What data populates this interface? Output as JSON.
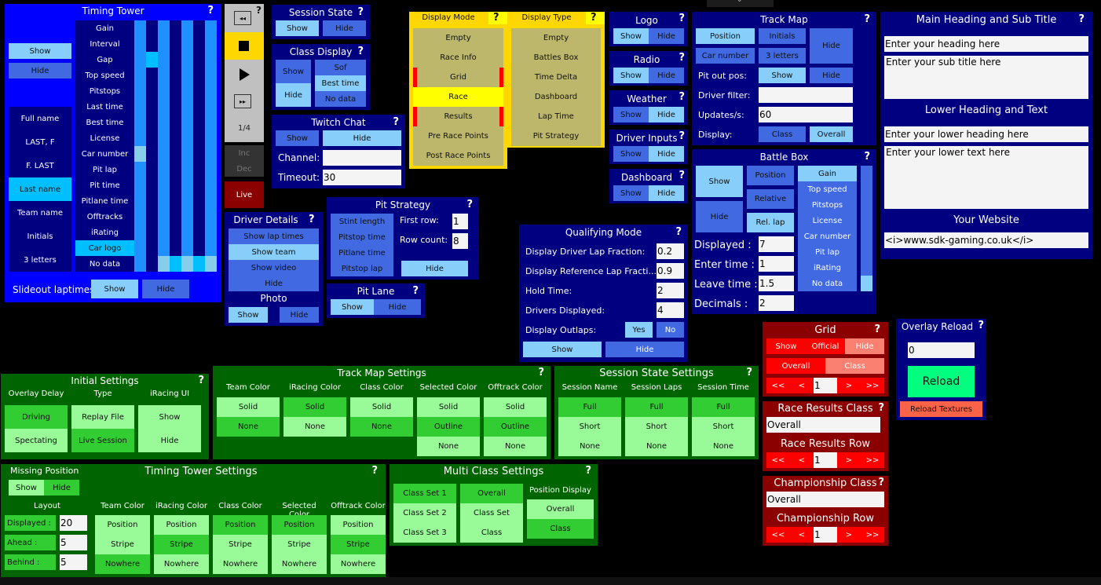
{
  "colors": {
    "panel_blue": "#000080",
    "bright_blue": "#0000ff",
    "light": "#87cefa",
    "mid": "#4169e1",
    "cyan": "#00bfff",
    "yellow": "#ffd700",
    "green": "#006400",
    "red": "#8b0000",
    "reload": "#00ff7f"
  },
  "help": "?",
  "timing_tower": {
    "title": "Timing Tower",
    "show": "Show",
    "hide": "Hide",
    "name_formats": [
      "Full name",
      "LAST, F",
      "F. LAST",
      "Last name",
      "Team name",
      "Initials",
      "3 letters"
    ],
    "selected_name_format": "Last name",
    "columns": [
      "Gain",
      "Interval",
      "Gap",
      "Top speed",
      "Pitstops",
      "Last time",
      "Best time",
      "License",
      "Car number",
      "Pit lap",
      "Pit time",
      "Pitlane time",
      "Offtracks",
      "iRating",
      "Car logo",
      "No data"
    ],
    "selected_column": "Car logo",
    "slideout_label": "Slideout laptimes",
    "slideout_show": "Show",
    "slideout_hide": "Hide"
  },
  "replay": {
    "rewind": "rewind-icon",
    "stop": "stop-icon",
    "play": "play-icon",
    "ffwd": "fast-forward-icon",
    "speed": "1/4",
    "inc": "Inc",
    "dec": "Dec",
    "live": "Live"
  },
  "session_state": {
    "title": "Session State",
    "show": "Show",
    "hide": "Hide"
  },
  "class_display": {
    "title": "Class Display",
    "show": "Show",
    "hide": "Hide",
    "options": [
      "Sof",
      "Best time",
      "No data"
    ]
  },
  "twitch_chat": {
    "title": "Twitch Chat",
    "show": "Show",
    "hide": "Hide",
    "channel_label": "Channel:",
    "channel_value": "",
    "timeout_label": "Timeout:",
    "timeout_value": "30"
  },
  "display_mode": {
    "title": "Display Mode",
    "items": [
      "Empty",
      "Race Info",
      "Grid",
      "Race",
      "Results",
      "Pre Race Points",
      "Post Race Points"
    ],
    "selected": "Race"
  },
  "display_type": {
    "title": "Display Type",
    "items": [
      "Empty",
      "Battles Box",
      "Time Delta",
      "Dashboard",
      "Lap Time",
      "Pit Strategy"
    ]
  },
  "small_panels": [
    {
      "title": "Logo",
      "show": "Show",
      "hide": "Hide"
    },
    {
      "title": "Radio",
      "show": "Show",
      "hide": "Hide"
    },
    {
      "title": "Weather",
      "show": "Show",
      "hide": "Hide"
    },
    {
      "title": "Driver Inputs",
      "show": "Show",
      "hide": "Hide"
    },
    {
      "title": "Dashboard",
      "show": "Show",
      "hide": "Hide"
    }
  ],
  "track_map": {
    "title": "Track Map",
    "position": "Position",
    "initials": "Initials",
    "car_number": "Car number",
    "three_letters": "3 letters",
    "hide": "Hide",
    "pit_out_label": "Pit out pos:",
    "pit_show": "Show",
    "pit_hide": "Hide",
    "driver_filter_label": "Driver filter:",
    "driver_filter_value": "",
    "updates_label": "Updates/s:",
    "updates_value": "60",
    "display_label": "Display:",
    "class": "Class",
    "overall": "Overall"
  },
  "battle_box": {
    "title": "Battle Box",
    "show": "Show",
    "hide": "Hide",
    "position": "Position",
    "relative": "Relative",
    "rel_lap": "Rel. lap",
    "columns": [
      "Gain",
      "Top speed",
      "Pitstops",
      "License",
      "Car number",
      "Pit lap",
      "iRating",
      "No data"
    ],
    "displayed_label": "Displayed :",
    "displayed_value": "7",
    "enter_label": "Enter time :",
    "enter_value": "1",
    "leave_label": "Leave time :",
    "leave_value": "1.5",
    "decimals_label": "Decimals :",
    "decimals_value": "2"
  },
  "headings": {
    "main_title": "Main Heading and Sub Title",
    "heading_value": "Enter your heading here",
    "subtitle_value": "Enter your sub title here",
    "lower_title": "Lower Heading and Text",
    "lower_heading_value": "Enter your lower heading here",
    "lower_text_value": "Enter your lower text here",
    "website_title": "Your Website",
    "website_value": "<i>www.sdk-gaming.co.uk</i>"
  },
  "driver_details": {
    "title": "Driver Details",
    "items": [
      "Show lap times",
      "Show team",
      "Show video",
      "Hide"
    ],
    "photo_title": "Photo",
    "photo_show": "Show",
    "photo_hide": "Hide"
  },
  "pit_strategy": {
    "title": "Pit Strategy",
    "items": [
      "Stint length",
      "Pitstop time",
      "Pitlane time",
      "Pitstop lap"
    ],
    "first_row_label": "First row:",
    "first_row_value": "1",
    "row_count_label": "Row count:",
    "row_count_value": "8",
    "hide": "Hide"
  },
  "pit_lane": {
    "title": "Pit Lane",
    "show": "Show",
    "hide": "Hide"
  },
  "qualifying": {
    "title": "Qualifying Mode",
    "rows": [
      {
        "label": "Display Driver Lap Fraction:",
        "value": "0.2"
      },
      {
        "label": "Display Reference Lap Fracti...",
        "value": "0.9"
      },
      {
        "label": "Hold Time:",
        "value": "2"
      },
      {
        "label": "Drivers Displayed:",
        "value": "4"
      }
    ],
    "outlaps_label": "Display Outlaps:",
    "yes": "Yes",
    "no": "No",
    "show": "Show",
    "hide": "Hide"
  },
  "grid": {
    "title": "Grid",
    "show": "Show",
    "official": "Official",
    "hide": "Hide",
    "overall": "Overall",
    "class": "Class",
    "first": "<<",
    "prev": "<",
    "value": "1",
    "next": ">",
    "last": ">>"
  },
  "race_results": {
    "title": "Race Results Class",
    "class_value": "Overall",
    "row_title": "Race Results Row",
    "first": "<<",
    "prev": "<",
    "value": "1",
    "next": ">",
    "last": ">>"
  },
  "championship": {
    "title": "Championship Class",
    "class_value": "Overall",
    "row_title": "Championship Row",
    "first": "<<",
    "prev": "<",
    "value": "1",
    "next": ">",
    "last": ">>"
  },
  "overlay_reload": {
    "title": "Overlay Reload",
    "value": "0",
    "reload": "Reload",
    "reload_textures": "Reload Textures"
  },
  "initial_settings": {
    "title": "Initial Settings",
    "cols": [
      {
        "header": "Overlay Delay",
        "items": [
          "Driving",
          "Spectating"
        ]
      },
      {
        "header": "Type",
        "items": [
          "Replay File",
          "Live Session"
        ]
      },
      {
        "header": "iRacing UI",
        "items": [
          "Show",
          "Hide"
        ]
      }
    ]
  },
  "track_map_settings": {
    "title": "Track Map Settings",
    "cols": [
      {
        "header": "Team Color",
        "items": [
          "Solid",
          "None"
        ]
      },
      {
        "header": "iRacing Color",
        "items": [
          "Solid",
          "None"
        ]
      },
      {
        "header": "Class Color",
        "items": [
          "Solid",
          "None"
        ]
      },
      {
        "header": "Selected Color",
        "items": [
          "Solid",
          "Outline",
          "None"
        ]
      },
      {
        "header": "Offtrack Color",
        "items": [
          "Solid",
          "Outline",
          "None"
        ]
      }
    ]
  },
  "session_state_settings": {
    "title": "Session State Settings",
    "cols": [
      {
        "header": "Session Name",
        "items": [
          "Full",
          "Short",
          "None"
        ]
      },
      {
        "header": "Session Laps",
        "items": [
          "Full",
          "Short",
          "None"
        ]
      },
      {
        "header": "Session Time",
        "items": [
          "Full",
          "Short",
          "None"
        ]
      }
    ]
  },
  "timing_tower_settings": {
    "title": "Timing Tower Settings",
    "missing_title": "Missing Position",
    "missing_show": "Show",
    "missing_hide": "Hide",
    "layout_title": "Layout",
    "layout": [
      {
        "label": "Displayed :",
        "value": "20"
      },
      {
        "label": "Ahead :",
        "value": "5"
      },
      {
        "label": "Behind :",
        "value": "5"
      }
    ],
    "cols": [
      {
        "header": "Team Color",
        "items": [
          "Position",
          "Stripe",
          "Nowhere"
        ]
      },
      {
        "header": "iRacing Color",
        "items": [
          "Position",
          "Stripe",
          "Nowhere"
        ]
      },
      {
        "header": "Class Color",
        "items": [
          "Position",
          "Stripe",
          "Nowhere"
        ]
      },
      {
        "header": "Selected Color",
        "items": [
          "Position",
          "Stripe",
          "Nowhere"
        ]
      },
      {
        "header": "Offtrack Color",
        "items": [
          "Position",
          "Stripe",
          "Nowhere"
        ]
      }
    ]
  },
  "multi_class": {
    "title": "Multi Class Settings",
    "sets": [
      "Class Set 1",
      "Class Set 2",
      "Class Set 3"
    ],
    "modes": [
      "Overall",
      "Class Set",
      "Class"
    ],
    "position_title": "Position Display",
    "position": [
      "Overall",
      "Class"
    ]
  }
}
